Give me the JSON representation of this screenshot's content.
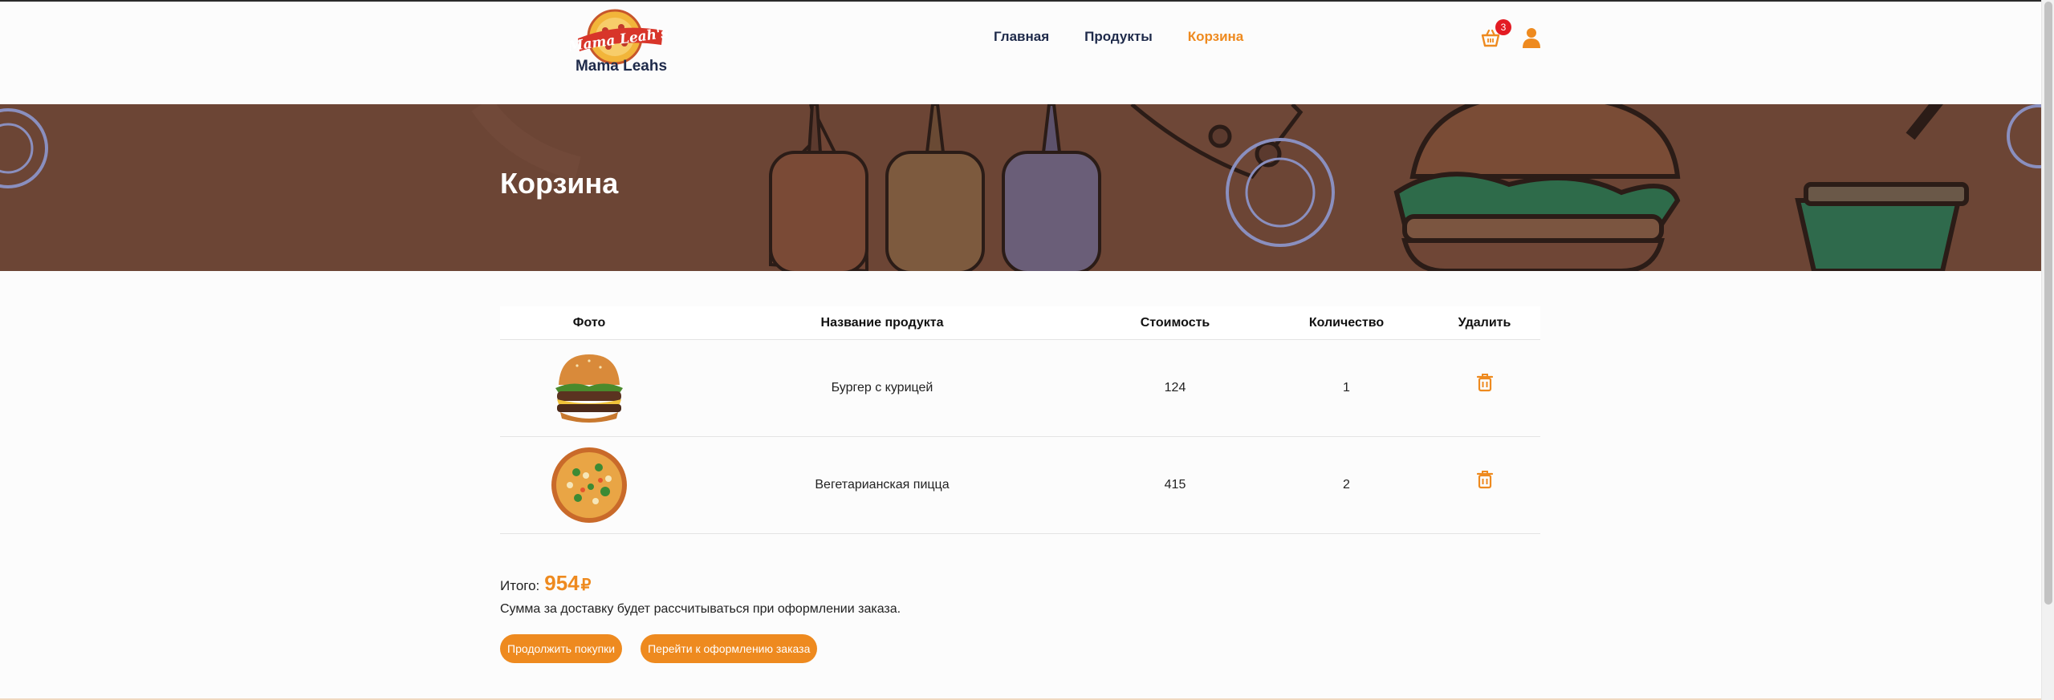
{
  "brand": {
    "name": "Mama Leahs",
    "logo_text": "Mama Leah's"
  },
  "nav": [
    {
      "label": "Главная",
      "active": false
    },
    {
      "label": "Продукты",
      "active": false
    },
    {
      "label": "Корзина",
      "active": true
    }
  ],
  "header": {
    "cart_count": "3",
    "cart_icon": "basket-icon",
    "user_icon": "user-icon"
  },
  "banner": {
    "title": "Корзина"
  },
  "table": {
    "columns": [
      "Фото",
      "Название продукта",
      "Стоимость",
      "Количество",
      "Удалить"
    ],
    "rows": [
      {
        "photo": "burger-image",
        "name": "Бургер с курицей",
        "price": "124",
        "quantity": "1",
        "delete_icon": "trash-icon"
      },
      {
        "photo": "pizza-image",
        "name": "Вегетарианская пицца",
        "price": "415",
        "quantity": "2",
        "delete_icon": "trash-icon"
      }
    ]
  },
  "summary": {
    "total_label": "Итого:",
    "total_amount": "954",
    "currency": "₽",
    "delivery_note": "Сумма за доставку будет рассчитываться при оформлении заказа."
  },
  "buttons": {
    "continue": "Продолжить покупки",
    "checkout": "Перейти к оформлению заказа"
  },
  "colors": {
    "accent": "#ee8a1f",
    "banner": "#6c4535",
    "nav_text": "#1e2a4a",
    "badge": "#e31b23"
  }
}
